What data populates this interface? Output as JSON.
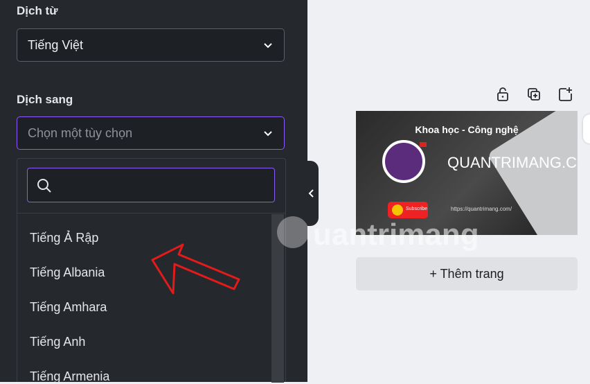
{
  "source_language": {
    "label": "Dịch từ",
    "selected": "Tiếng Việt"
  },
  "target_language": {
    "label": "Dịch sang",
    "placeholder": "Chọn một tùy chọn"
  },
  "language_search": {
    "value": "",
    "options": [
      "Tiếng Ả Rập",
      "Tiếng Albania",
      "Tiếng Amhara",
      "Tiếng Anh",
      "Tiếng Armenia"
    ]
  },
  "canvas": {
    "page_thumbnail": {
      "title": "Khoa học - Công nghệ",
      "site": "QUANTRIMANG.COM",
      "url": "https://quantrimang.com/",
      "subscribe": "Subscribe"
    },
    "add_page_label": "+ Thêm trang"
  },
  "watermark": "uantrimang",
  "colors": {
    "panel_bg": "#25282d",
    "accent": "#8b5cf6",
    "annotation_arrow": "#e31b1b"
  }
}
